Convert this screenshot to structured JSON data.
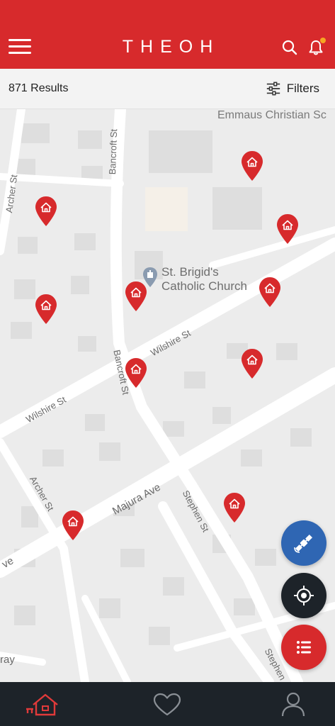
{
  "header": {
    "brand": "THEOH",
    "colors": {
      "brand_red": "#d72a2c",
      "notification_dot": "#f5a623"
    },
    "icons": [
      "menu-icon",
      "search-icon",
      "bell-icon"
    ]
  },
  "results": {
    "count_label": "871 Results",
    "filters_label": "Filters"
  },
  "map": {
    "labels": {
      "school": "Emmaus Christian Sc",
      "poi_line1": "St. Brigid's",
      "poi_line2": "Catholic Church",
      "bancroft_1": "Bancroft St",
      "bancroft_2": "Bancroft St",
      "archer_1": "Archer St",
      "archer_2": "Archer St",
      "wilshire_1": "Wilshire St",
      "wilshire_2": "Wilshire St",
      "majura": "Majura Ave",
      "stephen_1": "Stephen St",
      "stephen_2": "Stephen",
      "ave_edge": "ve",
      "ray_edge": "ray"
    },
    "property_pin_count": 11,
    "pin_color": "#d72a2c"
  },
  "fabs": {
    "satellite": {
      "icon": "satellite-icon",
      "color": "#2f66b3"
    },
    "locate": {
      "icon": "crosshair-icon",
      "color": "#1d2329"
    },
    "list": {
      "icon": "list-icon",
      "color": "#d72a2c"
    }
  },
  "bottom_nav": {
    "items": [
      "home-icon",
      "heart-icon",
      "profile-icon"
    ],
    "active": "home-icon"
  }
}
